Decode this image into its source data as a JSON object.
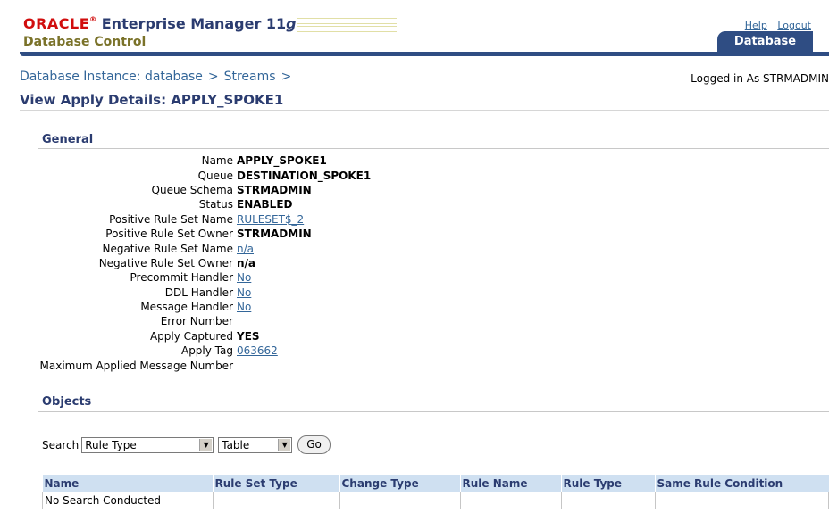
{
  "header": {
    "brand_oracle": "ORACLE",
    "brand_product": "Enterprise Manager 11",
    "brand_version": "g",
    "subtitle": "Database Control",
    "links": {
      "help": "Help",
      "logout": "Logout"
    },
    "tab_label": "Database"
  },
  "breadcrumb": {
    "item1": "Database Instance: database",
    "sep": ">",
    "item2": "Streams"
  },
  "logged_in": "Logged in As STRMADMIN",
  "page_title": "View Apply Details: APPLY_SPOKE1",
  "general": {
    "heading": "General",
    "name_label": "Name",
    "name_value": "APPLY_SPOKE1",
    "queue_label": "Queue",
    "queue_value": "DESTINATION_SPOKE1",
    "queue_schema_label": "Queue Schema",
    "queue_schema_value": "STRMADMIN",
    "status_label": "Status",
    "status_value": "ENABLED",
    "pos_rule_set_name_label": "Positive Rule Set Name",
    "pos_rule_set_name_value": "RULESET$_2",
    "pos_rule_set_owner_label": "Positive Rule Set Owner",
    "pos_rule_set_owner_value": "STRMADMIN",
    "neg_rule_set_name_label": "Negative Rule Set Name",
    "neg_rule_set_name_value": "n/a",
    "neg_rule_set_owner_label": "Negative Rule Set Owner",
    "neg_rule_set_owner_value": "n/a",
    "precommit_handler_label": "Precommit Handler",
    "precommit_handler_value": "No",
    "ddl_handler_label": "DDL Handler",
    "ddl_handler_value": "No",
    "message_handler_label": "Message Handler",
    "message_handler_value": "No",
    "error_number_label": "Error Number",
    "error_number_value": "",
    "apply_captured_label": "Apply Captured",
    "apply_captured_value": "YES",
    "apply_tag_label": "Apply Tag",
    "apply_tag_value": "063662",
    "max_applied_label": "Maximum Applied Message Number",
    "max_applied_value": ""
  },
  "objects": {
    "heading": "Objects",
    "search_label": "Search",
    "search_type_value": "Rule Type",
    "search_object_value": "Table",
    "go_label": "Go",
    "columns": [
      "Name",
      "Rule Set Type",
      "Change Type",
      "Rule Name",
      "Rule Type",
      "Same Rule Condition"
    ],
    "empty_message": "No Search Conducted"
  }
}
